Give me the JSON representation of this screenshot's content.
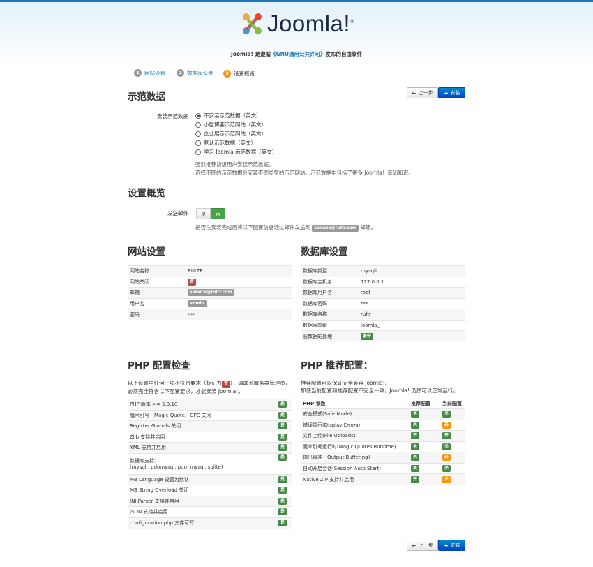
{
  "brand": {
    "name": "Joomla!",
    "reg": "®"
  },
  "tagline": {
    "pre": "Joomla! 是遵循",
    "link": "《GNU通用公共许可》",
    "post": "发布的自由软件"
  },
  "tabs": [
    {
      "num": "1",
      "label": "网站设置"
    },
    {
      "num": "2",
      "label": "数据库设置"
    },
    {
      "num": "3",
      "label": "设置概览"
    }
  ],
  "nav": {
    "prev": "上一步",
    "install": "安装",
    "prev_icon": "←",
    "install_icon": "➔"
  },
  "sample": {
    "title": "示范数据",
    "label": "安装示范数据",
    "options": [
      "不安装示范数据（英文）",
      "小型博客示范网站（英文）",
      "企业展示示范网站（英文）",
      "默认示范数据（英文）",
      "学习 Joomla 示范数据（英文）"
    ],
    "note1": "强烈推荐初级用户安装示范数据。",
    "note2": "选择不同的示范数据会安装不同类型的示范网站。示范数据中包括了很多 Joomla！基础知识。"
  },
  "overview": {
    "title": "设置概览",
    "mail_label": "发送邮件",
    "yes": "是",
    "no": "否",
    "note_pre": "是否在安装完成后将以下配置信息通过邮件发送到",
    "note_email": "service@rultr.com",
    "note_post": "邮箱。"
  },
  "site": {
    "title": "网站设置",
    "rows": [
      {
        "k": "网站名称",
        "v": "RULTR"
      },
      {
        "k": "网站关闭",
        "badge": "否"
      },
      {
        "k": "邮箱",
        "badge": "service@rultr.com"
      },
      {
        "k": "用户名",
        "badge": "admin"
      },
      {
        "k": "密码",
        "v": "***"
      }
    ]
  },
  "db": {
    "title": "数据库设置",
    "rows": [
      {
        "k": "数据库类型",
        "v": "mysqli"
      },
      {
        "k": "数据库主机名",
        "v": "127.0.0.1"
      },
      {
        "k": "数据库用户名",
        "v": "root"
      },
      {
        "k": "数据库密码",
        "v": "***"
      },
      {
        "k": "数据库名称",
        "v": "rultr"
      },
      {
        "k": "数据表前缀",
        "v": "joomla_"
      },
      {
        "k": "旧数据的处理",
        "badge": "备份"
      }
    ]
  },
  "php_check": {
    "title": "PHP 配置检查",
    "intro1_pre": "以下设置中任何一项不符合要求（标记为",
    "intro1_badge": "否",
    "intro1_post": "），请联系服务器管理员，",
    "intro2": "必须完全符合以下配置要求，才能安装 Joomla!。",
    "yes": "是",
    "rows": [
      "PHP 版本 >= 5.3.10",
      "魔术引号（Magic Quote）GPC 关闭",
      "Register Globals 关闭",
      "Zlib 支持并启用",
      "XML 支持并启用",
      "数据库支持：",
      "MB Language 设置为默认",
      "MB String Overload 关闭",
      "INI Parser 支持并启用",
      "JSON 支持并启用",
      "configuration.php 文件可写"
    ],
    "db_support_detail": "(mysqli, pdomysql, pdo, mysql, sqlite)"
  },
  "php_rec": {
    "title": "PHP 推荐配置：",
    "intro1": "推荐配置可以保证完全兼容 joomla!。",
    "intro2": "即使当前配置和推荐配置不完全一致，Joomla! 仍然可以正常运行。",
    "headers": [
      "PHP 参数",
      "推荐配置",
      "当前配置"
    ],
    "rows": [
      {
        "k": "安全模式(Safe Mode)",
        "rec": "关",
        "cur": "关",
        "cur_color": "green"
      },
      {
        "k": "错误显示(Display Errors)",
        "rec": "关",
        "cur": "开",
        "cur_color": "orange"
      },
      {
        "k": "文件上传(File Uploads)",
        "rec": "开",
        "cur": "开",
        "cur_color": "green"
      },
      {
        "k": "魔术引号运行时(Magic Quotes Runtime)",
        "rec": "关",
        "cur": "关",
        "cur_color": "green"
      },
      {
        "k": "输出缓冲（Output Buffering)",
        "rec": "关",
        "cur": "开",
        "cur_color": "orange"
      },
      {
        "k": "自动开启会话(Session Auto Start)",
        "rec": "关",
        "cur": "关",
        "cur_color": "green"
      },
      {
        "k": "Native ZIP 支持并启用",
        "rec": "开",
        "cur": "关",
        "cur_color": "orange"
      }
    ]
  }
}
